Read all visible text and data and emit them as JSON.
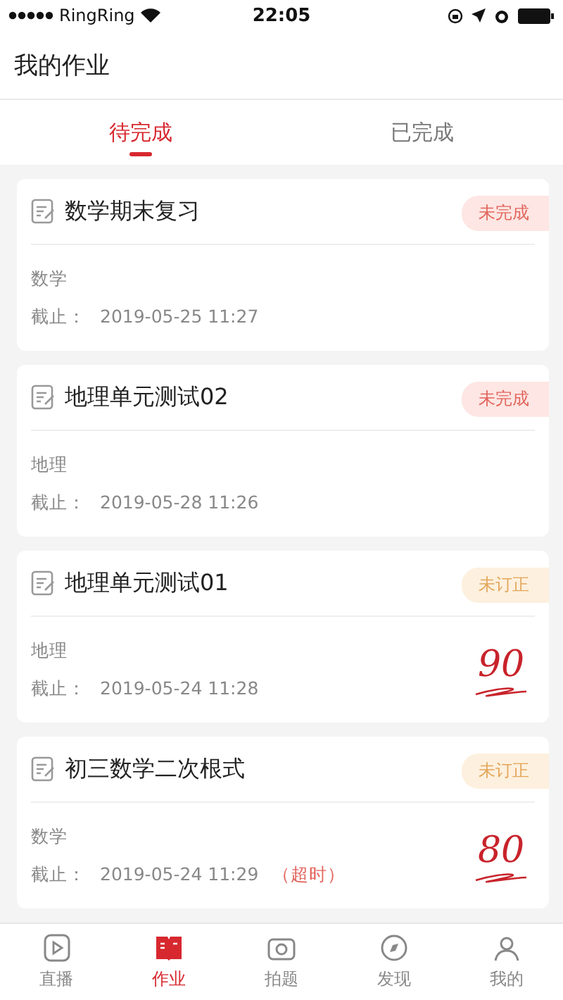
{
  "status_bar": {
    "carrier": "RingRing",
    "time": "22:05"
  },
  "header": {
    "title": "我的作业"
  },
  "tabs": [
    {
      "label": "待完成",
      "selected": true
    },
    {
      "label": "已完成",
      "selected": false
    }
  ],
  "assignments": [
    {
      "title": "数学期末复习",
      "badge": {
        "label": "未完成",
        "kind": "unfinished"
      },
      "subject": "数学",
      "deadline_label": "截止：",
      "deadline": "2019-05-25 11:27"
    },
    {
      "title": "地理单元测试02",
      "badge": {
        "label": "未完成",
        "kind": "unfinished"
      },
      "subject": "地理",
      "deadline_label": "截止：",
      "deadline": "2019-05-28 11:26"
    },
    {
      "title": "地理单元测试01",
      "badge": {
        "label": "未订正",
        "kind": "uncorrected"
      },
      "subject": "地理",
      "deadline_label": "截止：",
      "deadline": "2019-05-24 11:28",
      "score": "90"
    },
    {
      "title": "初三数学二次根式",
      "badge": {
        "label": "未订正",
        "kind": "uncorrected"
      },
      "subject": "数学",
      "deadline_label": "截止：",
      "deadline": "2019-05-24 11:29",
      "overdue": "（超时）",
      "score": "80"
    }
  ],
  "bottom_nav": [
    {
      "label": "直播",
      "selected": false
    },
    {
      "label": "作业",
      "selected": true
    },
    {
      "label": "拍题",
      "selected": false
    },
    {
      "label": "发现",
      "selected": false
    },
    {
      "label": "我的",
      "selected": false
    }
  ]
}
